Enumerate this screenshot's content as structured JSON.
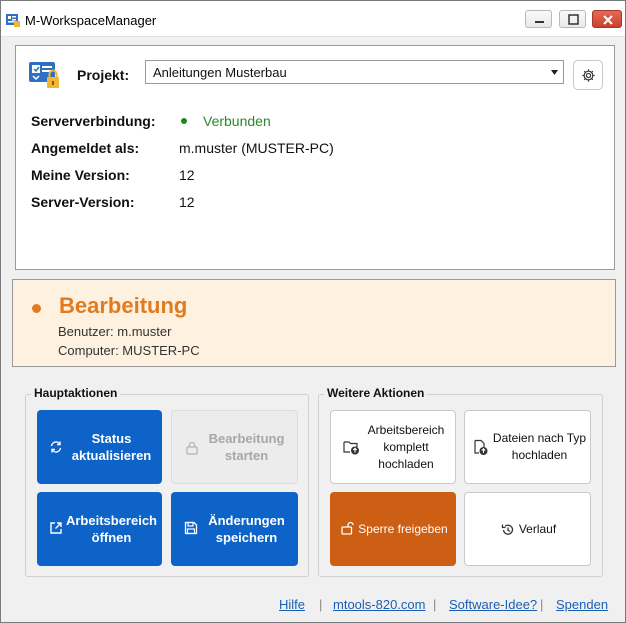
{
  "window": {
    "title": "M-WorkspaceManager"
  },
  "project": {
    "label": "Projekt:",
    "selected": "Anleitungen Musterbau"
  },
  "info": {
    "server_label": "Serververbindung:",
    "server_value": "Verbunden",
    "user_label": "Angemeldet als:",
    "user_value": "m.muster (MUSTER-PC)",
    "my_version_label": "Meine Version:",
    "my_version_value": "12",
    "server_version_label": "Server-Version:",
    "server_version_value": "12"
  },
  "edit_status": {
    "title": "Bearbeitung",
    "user_line": "Benutzer: m.muster",
    "computer_line": "Computer: MUSTER-PC"
  },
  "main_actions": {
    "title": "Hauptaktionen",
    "refresh_line1": "Status",
    "refresh_line2": "aktualisieren",
    "start_line1": "Bearbeitung",
    "start_line2": "starten",
    "open_line1": "Arbeitsbereich",
    "open_line2": "öffnen",
    "save_line1": "Änderungen",
    "save_line2": "speichern"
  },
  "more_actions": {
    "title": "Weitere Aktionen",
    "upload_line1": "Arbeitsbereich",
    "upload_line2": "komplett",
    "upload_line3": "hochladen",
    "upload_type_line1": "Dateien nach Typ",
    "upload_type_line2": "hochladen",
    "release": "Sperre freigeben",
    "history": "Verlauf"
  },
  "footer": {
    "help": "Hilfe",
    "site": "mtools-820.com",
    "idea": "Software-Idee?",
    "donate": "Spenden",
    "separator": "|"
  },
  "colors": {
    "primary_blue": "#0d63c7",
    "status_green": "#2a8a2a",
    "edit_orange": "#e07b20",
    "release_orange": "#cc5f13",
    "edit_panel_bg": "#fff1df"
  }
}
